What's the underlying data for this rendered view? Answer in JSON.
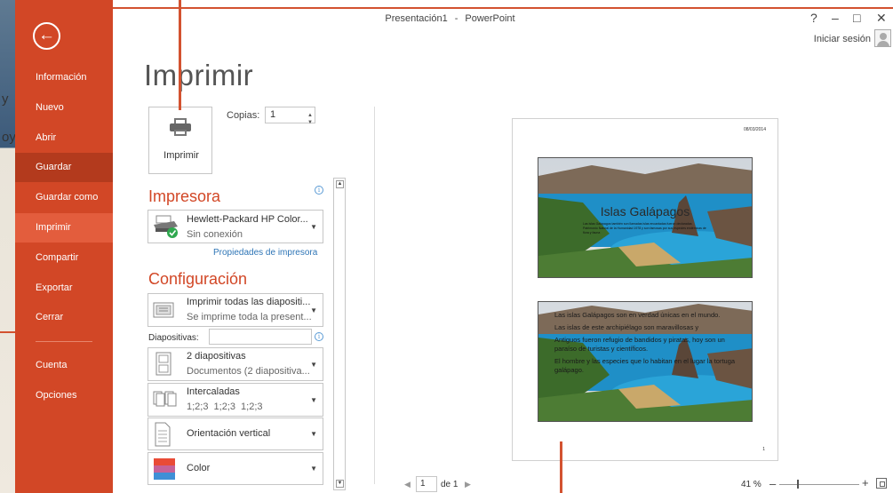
{
  "window": {
    "doc_title": "Presentación1",
    "separator": "-",
    "app_name": "PowerPoint",
    "help": "?",
    "minimize": "–",
    "maximize": "□",
    "close": "✕",
    "sign_in": "Iniciar sesión"
  },
  "background_slide": {
    "line1": "y",
    "line2": "oy"
  },
  "nav": {
    "back": "←",
    "items": [
      {
        "label": "Información"
      },
      {
        "label": "Nuevo"
      },
      {
        "label": "Abrir"
      },
      {
        "label": "Guardar"
      },
      {
        "label": "Guardar como"
      },
      {
        "label": "Imprimir"
      },
      {
        "label": "Compartir"
      },
      {
        "label": "Exportar"
      },
      {
        "label": "Cerrar"
      },
      {
        "label": "Cuenta"
      },
      {
        "label": "Opciones"
      }
    ],
    "active": "Imprimir"
  },
  "page_title": "Imprimir",
  "print_button": {
    "label": "Imprimir"
  },
  "copies": {
    "label": "Copias:",
    "value": "1"
  },
  "printer": {
    "heading": "Impresora",
    "name": "Hewlett-Packard HP Color...",
    "status": "Sin conexión",
    "properties_link": "Propiedades de impresora"
  },
  "settings": {
    "heading": "Configuración",
    "range": {
      "main": "Imprimir todas las diapositi...",
      "sub": "Se imprime toda la present..."
    },
    "slides_label": "Diapositivas:",
    "slides_value": "",
    "layout": {
      "main": "2 diapositivas",
      "sub": "Documentos (2 diapositiva..."
    },
    "collate": {
      "main": "Intercaladas",
      "sub": "1;2;3    1;2;3    1;2;3"
    },
    "orientation": {
      "main": "Orientación vertical"
    },
    "color": {
      "main": "Color"
    }
  },
  "preview": {
    "date": "08/03/2014",
    "page_number": "1",
    "slide1_title": "Islas Galápagos",
    "slide1_subtitle": "Las islas Galápagos también son llamadas islas encantadas fueron declaradas Patrimonio Natural de la Humanidad 1978 y son famosas por sus especies endémicas de flora y fauna",
    "slide2_bullets": [
      "Las islas Galápagos son en verdad únicas en el mundo.",
      "Las islas de este archipiélago son maravillosas y",
      "Antiguos fueron refugio de bandidos y piratas, hoy son un paraíso de turistas y científicos.",
      "El hombre y las especies que lo habitan en el lugar la tortuga galápago."
    ]
  },
  "pager": {
    "prev": "◀",
    "current": "1",
    "of": "de 1",
    "next": "▶"
  },
  "zoom": {
    "percent": "41 %",
    "minus": "–",
    "plus": "+",
    "level": 0.41
  },
  "colors": {
    "accent": "#d24726",
    "nav_saved": "#b33a1d",
    "nav_active": "#e35d3d",
    "link": "#2e75b6"
  }
}
